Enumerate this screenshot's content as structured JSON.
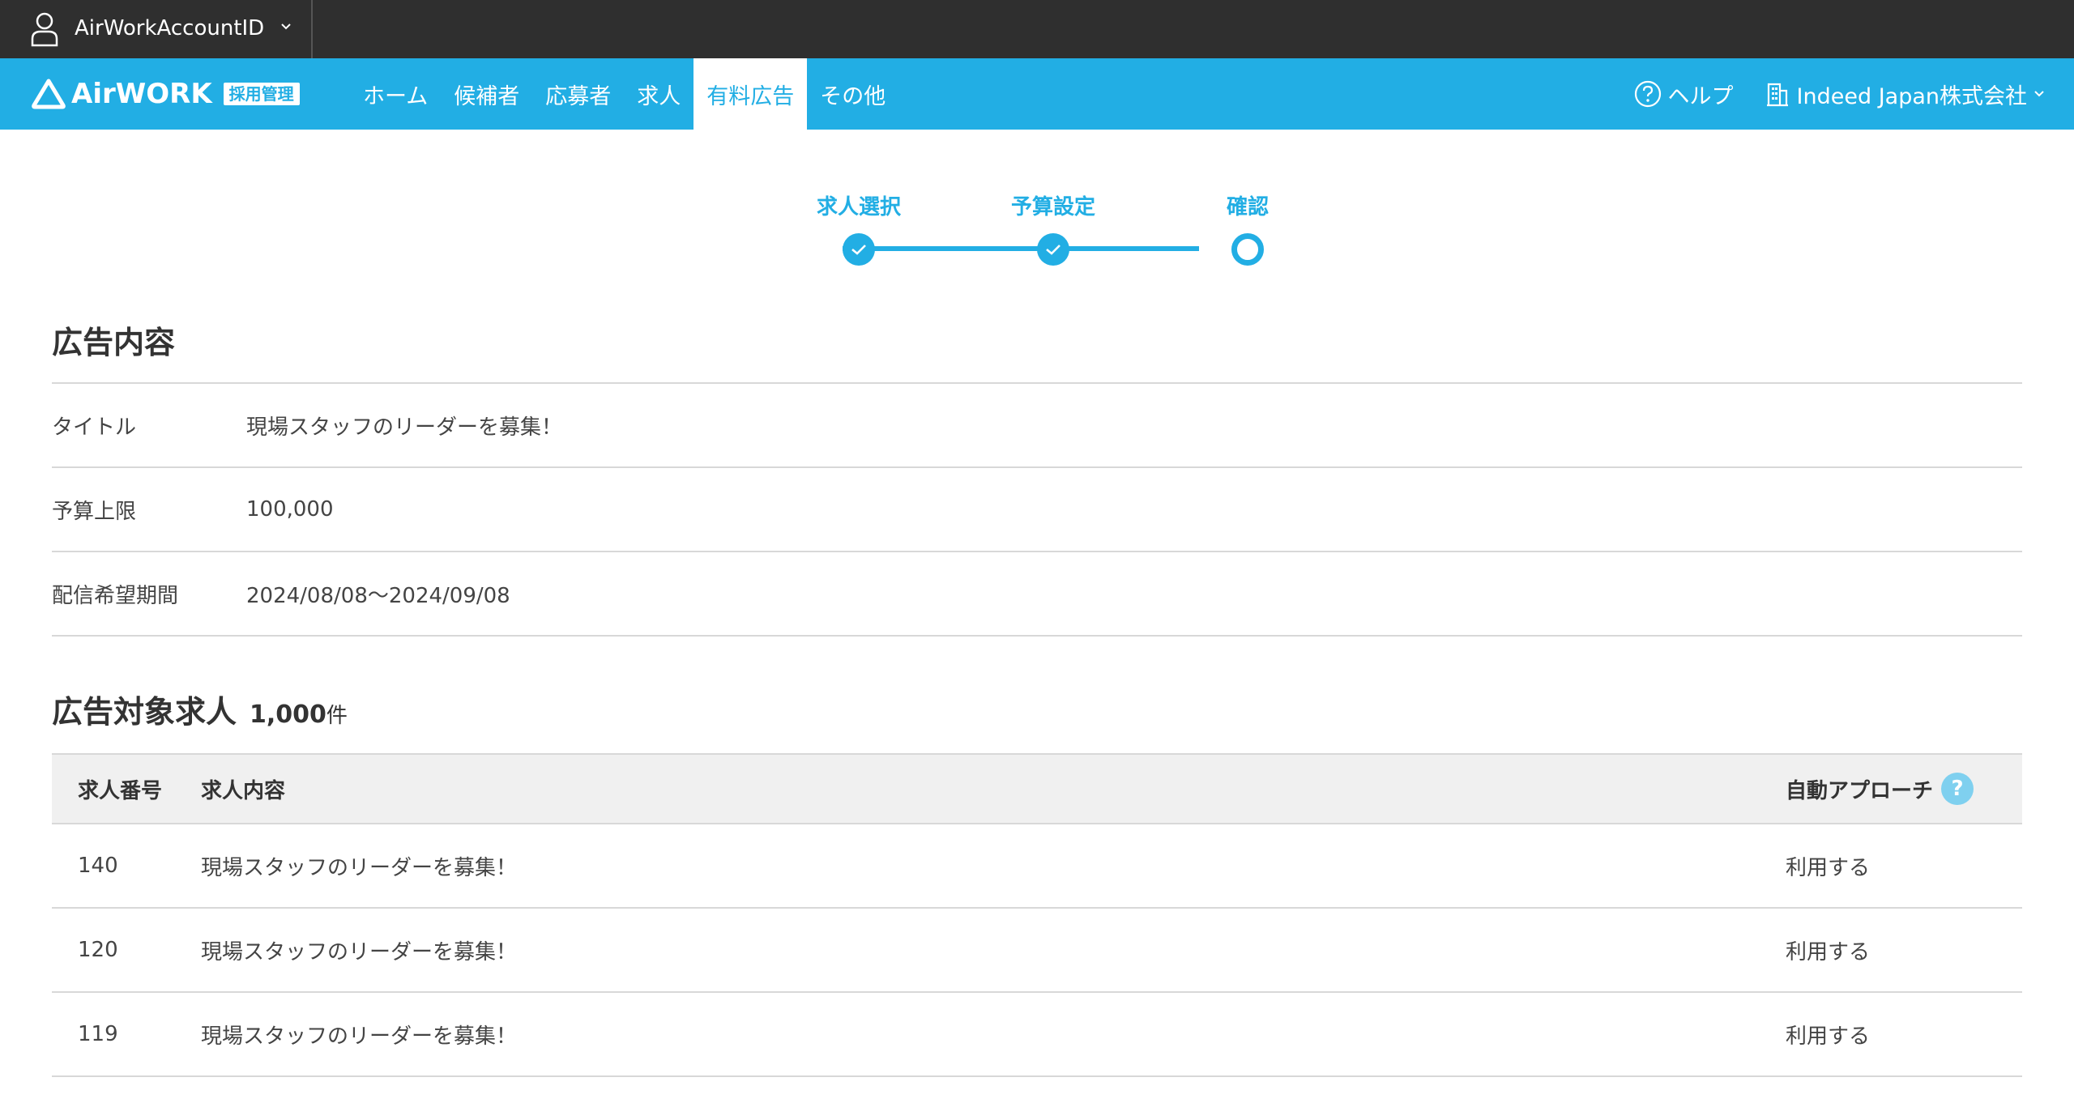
{
  "account_bar": {
    "account_name": "AirWorkAccountID"
  },
  "nav": {
    "logo_text": "AirWORK",
    "logo_badge": "採用管理",
    "tabs": [
      {
        "label": "ホーム"
      },
      {
        "label": "候補者"
      },
      {
        "label": "応募者"
      },
      {
        "label": "求人"
      },
      {
        "label": "有料広告",
        "active": true
      },
      {
        "label": "その他"
      }
    ],
    "help_label": "ヘルプ",
    "company_name": "Indeed Japan株式会社"
  },
  "stepper": {
    "steps": [
      {
        "label": "求人選択",
        "state": "done"
      },
      {
        "label": "予算設定",
        "state": "done"
      },
      {
        "label": "確認",
        "state": "current"
      }
    ]
  },
  "ad_content": {
    "title": "広告内容",
    "rows": [
      {
        "label": "タイトル",
        "value": "現場スタッフのリーダーを募集！"
      },
      {
        "label": "予算上限",
        "value": "100,000"
      },
      {
        "label": "配信希望期間",
        "value": "2024/08/08〜2024/09/08"
      }
    ]
  },
  "target_jobs": {
    "title": "広告対象求人",
    "count": "1,000",
    "count_unit": "件",
    "headers": {
      "number": "求人番号",
      "content": "求人内容",
      "auto_approach": "自動アプローチ",
      "help_glyph": "?"
    },
    "rows": [
      {
        "number": "140",
        "content": "現場スタッフのリーダーを募集！",
        "auto_approach": "利用する"
      },
      {
        "number": "120",
        "content": "現場スタッフのリーダーを募集！",
        "auto_approach": "利用する"
      },
      {
        "number": "119",
        "content": "現場スタッフのリーダーを募集！",
        "auto_approach": "利用する"
      }
    ]
  },
  "colors": {
    "accent": "#22aee4",
    "topbar": "#2f2f2f",
    "table_header_bg": "#f0f0f0"
  }
}
